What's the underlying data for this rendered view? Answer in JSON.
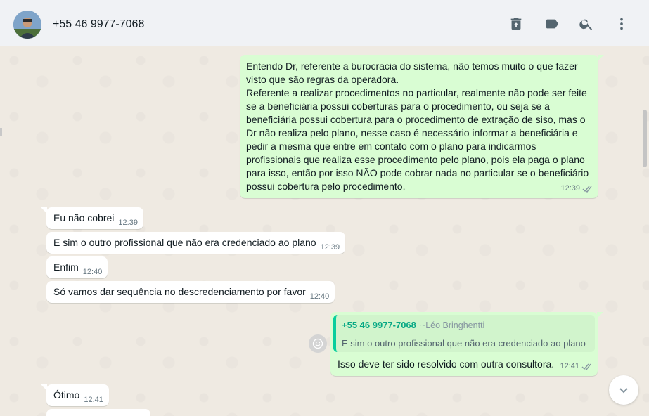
{
  "header": {
    "contact_name": "+55 46 9977-7068",
    "icons": [
      "delete-icon",
      "label-icon",
      "search-icon",
      "menu-icon"
    ]
  },
  "messages": [
    {
      "direction": "out",
      "text": "Entendo Dr, referente a burocracia do sistema, não temos muito o que fazer\nvisto que são regras da operadora.\nReferente a realizar procedimentos no particular, realmente não pode ser feite\nse a beneficiária possui coberturas para o procedimento, ou seja se a\nbeneficiária possui cobertura para o procedimento de extração de siso, mas o\nDr não realiza pelo plano, nesse caso é necessário informar a beneficiária e\npedir a mesma que entre em contato com o plano para indicarmos\nprofissionais que realiza esse procedimento pelo plano, pois ela paga o plano\npara isso, então por isso NÃO pode cobrar nada no particular se o beneficiário\npossui cobertura pelo procedimento.",
      "time": "12:39",
      "status": "read"
    },
    {
      "direction": "in",
      "text": "Eu não cobrei",
      "time": "12:39"
    },
    {
      "direction": "in",
      "text": "E sim o outro profissional que não era credenciado ao plano",
      "time": "12:39"
    },
    {
      "direction": "in",
      "text": "Enfim",
      "time": "12:40"
    },
    {
      "direction": "in",
      "text": "Só vamos dar sequência no descredenciamento por favor",
      "time": "12:40"
    },
    {
      "direction": "out",
      "quote": {
        "sender": "+55 46 9977-7068",
        "push_name": "~Léo Bringhentti",
        "text": "E sim o outro profissional que não era credenciado ao plano"
      },
      "text": "Isso deve ter sido resolvido com outra consultora.",
      "time": "12:41",
      "status": "read"
    },
    {
      "direction": "in",
      "text": "Ótimo",
      "time": "12:41"
    }
  ],
  "colors": {
    "incoming": "#ffffff",
    "outgoing": "#d9fdd3",
    "background": "#efeae2",
    "quote_accent": "#06cf9c",
    "read_tick": "#8696a0"
  }
}
